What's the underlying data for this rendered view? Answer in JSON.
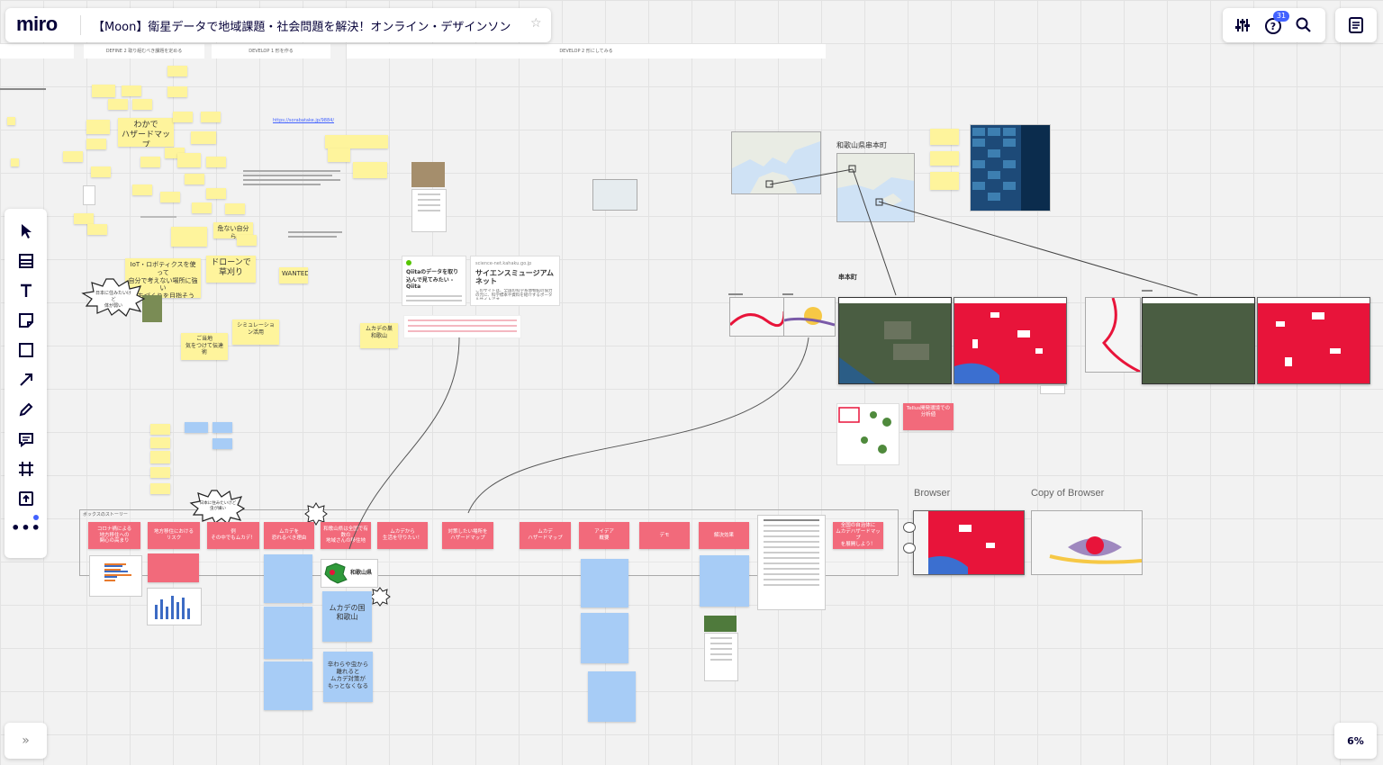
{
  "app": {
    "logo": "miro",
    "board_title": "【Moon】衛星データで地域課題・社会問題を解決！オンライン・デザインソン"
  },
  "toolbar_right": {
    "notifications_count": "31"
  },
  "zoom": "6%",
  "frames": {
    "define": "DEFINE 2 取り組むべき課題を定める",
    "develop1": "DEVELOP 1 形を作る",
    "develop2": "DEVELOP 2 形にしてみる"
  },
  "stickies_left": {
    "hazard_map": "わかで\nハザードマップ",
    "iot": "IoT・ロボティクスを使って\n自分で考えない場所に強い\nまちづくりを目指そう",
    "drone": "ドローンで\n草刈り",
    "wanted": "WANTED",
    "simulation": "シミュレーション活用",
    "care": "ご当地\n気をつけて伝達術",
    "mukade": "ムカデの巣\n和歌山",
    "dangerous": "危ない自分ら",
    "bubble_left": "日本に住みたいけど\n体が弱い"
  },
  "link_url": "https://sorabatake.jp/9884/",
  "cards": {
    "qiita_title": "Qiitaのデータを取り込んで見てみたい - Qiita",
    "science_domain": "science-net.kahaku.go.jp",
    "science_title": "サイエンスミュージアムネット",
    "science_desc": "このサイトは、全国の科学系博物館の協力の元に、科学標本や資料を紹介するポータルサイトです。"
  },
  "map_labels": {
    "wakayama": "和歌山県串本町",
    "kushimoto": "串本町",
    "tellus": "Tellus開発環境での分析値",
    "browser": "Browser",
    "copy_browser": "Copy of Browser"
  },
  "story": {
    "title": "ボックスのストーリー",
    "pink_row": [
      "コロナ禍による\n地方移住への\n関心の高まり",
      "地方移住における\nリスク",
      "例\nその中でもムカデ！",
      "ムカデを\n恐れるべき理由",
      "和歌山県は全国で有数の\n地域さんの移住地",
      "ムカデから\n生活を守りたい！",
      "対策したい場所を\nハザードマップ",
      "ムカデ\nハザードマップ",
      "アイデア\n概要",
      "デモ",
      "解決効果",
      "全国の自治体に\nムカデハザードマップ\nを展開しよう！"
    ],
    "bubble": "日本に住みたいけど\n虫が嫌い",
    "wakayama_label": "和歌山県",
    "mukade_note": "ムカデの国\n和歌山",
    "blue_note": "辛わらや虫から\n離れると\nムカデ対策が\nもっとなくなる"
  },
  "colors": {
    "accent": "#4262ff",
    "pink": "#f26a7b",
    "yellow": "#fef49c",
    "blue": "#a7ccf6"
  }
}
